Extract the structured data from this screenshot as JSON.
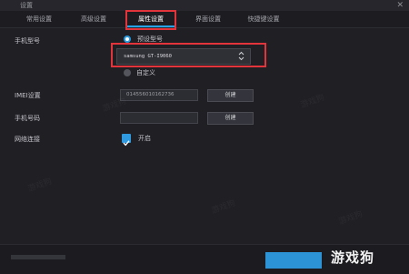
{
  "window": {
    "title": "设置",
    "close_glyph": "✕"
  },
  "tabs": [
    {
      "label": "常用设置",
      "active": false
    },
    {
      "label": "高级设置",
      "active": false
    },
    {
      "label": "属性设置",
      "active": true
    },
    {
      "label": "界面设置",
      "active": false
    },
    {
      "label": "快捷键设置",
      "active": false
    }
  ],
  "phone_model": {
    "label": "手机型号",
    "preset_option": "预设型号",
    "preset_selected": true,
    "select_value": "samsung GT-I9060",
    "custom_option": "自定义"
  },
  "imei": {
    "label": "IMEI设置",
    "value": "014556010162736",
    "button": "创建"
  },
  "phone_number": {
    "label": "手机号码",
    "value": "",
    "button": "创建"
  },
  "network": {
    "label": "网络连接",
    "checkbox_label": "开启",
    "checked": true
  },
  "watermark": {
    "logo": "游戏狗",
    "text": "游戏狗"
  },
  "colors": {
    "accent": "#2b99dc",
    "highlight": "#e4343b",
    "background": "#1f1f24"
  }
}
